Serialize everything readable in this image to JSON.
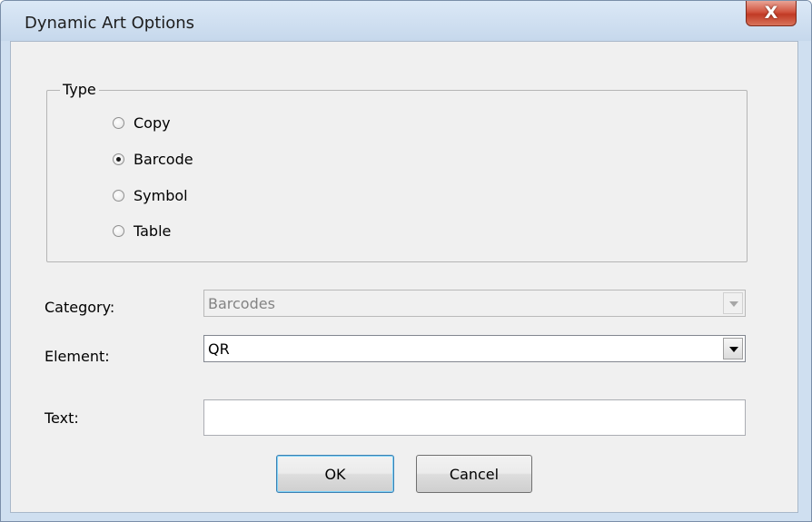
{
  "window": {
    "title": "Dynamic Art Options",
    "close_symbol": "X"
  },
  "type_group": {
    "legend": "Type",
    "options": [
      {
        "label": "Copy",
        "selected": false
      },
      {
        "label": "Barcode",
        "selected": true
      },
      {
        "label": "Symbol",
        "selected": false
      },
      {
        "label": "Table",
        "selected": false
      }
    ]
  },
  "category": {
    "label": "Category:",
    "value": "Barcodes",
    "enabled": false
  },
  "element": {
    "label": "Element:",
    "value": "QR",
    "enabled": true
  },
  "text": {
    "label": "Text:",
    "value": ""
  },
  "buttons": {
    "ok_label": "OK",
    "cancel_label": "Cancel"
  }
}
